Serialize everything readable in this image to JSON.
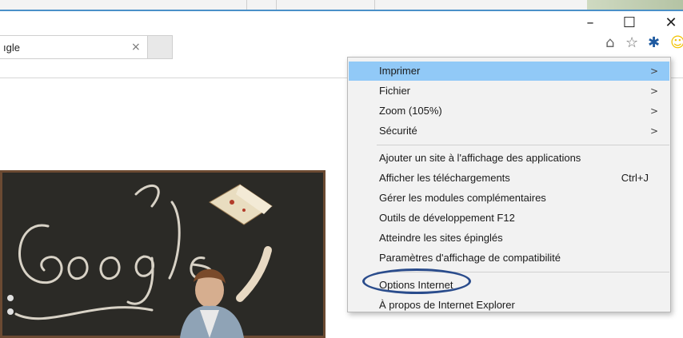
{
  "window": {
    "minimize_glyph": "–",
    "maximize_glyph": "☐",
    "close_glyph": "✕"
  },
  "tab": {
    "title": "ıgle",
    "close_glyph": "×"
  },
  "toolbar": {
    "home_icon": "home-icon",
    "favorites_icon": "star-icon",
    "tools_icon": "gear-icon",
    "feedback_icon": "smiley-icon"
  },
  "menu": {
    "items": [
      {
        "label": "Imprimer",
        "submenu": true,
        "highlighted": true
      },
      {
        "label": "Fichier",
        "submenu": true
      },
      {
        "label": "Zoom (105%)",
        "submenu": true
      },
      {
        "label": "Sécurité",
        "submenu": true
      },
      {
        "label": "Ajouter un site à l'affichage des applications"
      },
      {
        "label": "Afficher les téléchargements",
        "shortcut": "Ctrl+J"
      },
      {
        "label": "Gérer les modules complémentaires"
      },
      {
        "label": "Outils de développement F12"
      },
      {
        "label": "Atteindre les sites épinglés"
      },
      {
        "label": "Paramètres d'affichage de compatibilité"
      },
      {
        "label": "Options Internet",
        "annotated": true
      },
      {
        "label": "À propos de Internet Explorer"
      }
    ],
    "arrow_glyph": ">"
  },
  "colors": {
    "highlight": "#91c9f7",
    "annotation": "#2a4c8c",
    "gear": "#1e5aa0",
    "smiley": "#f2c200"
  }
}
